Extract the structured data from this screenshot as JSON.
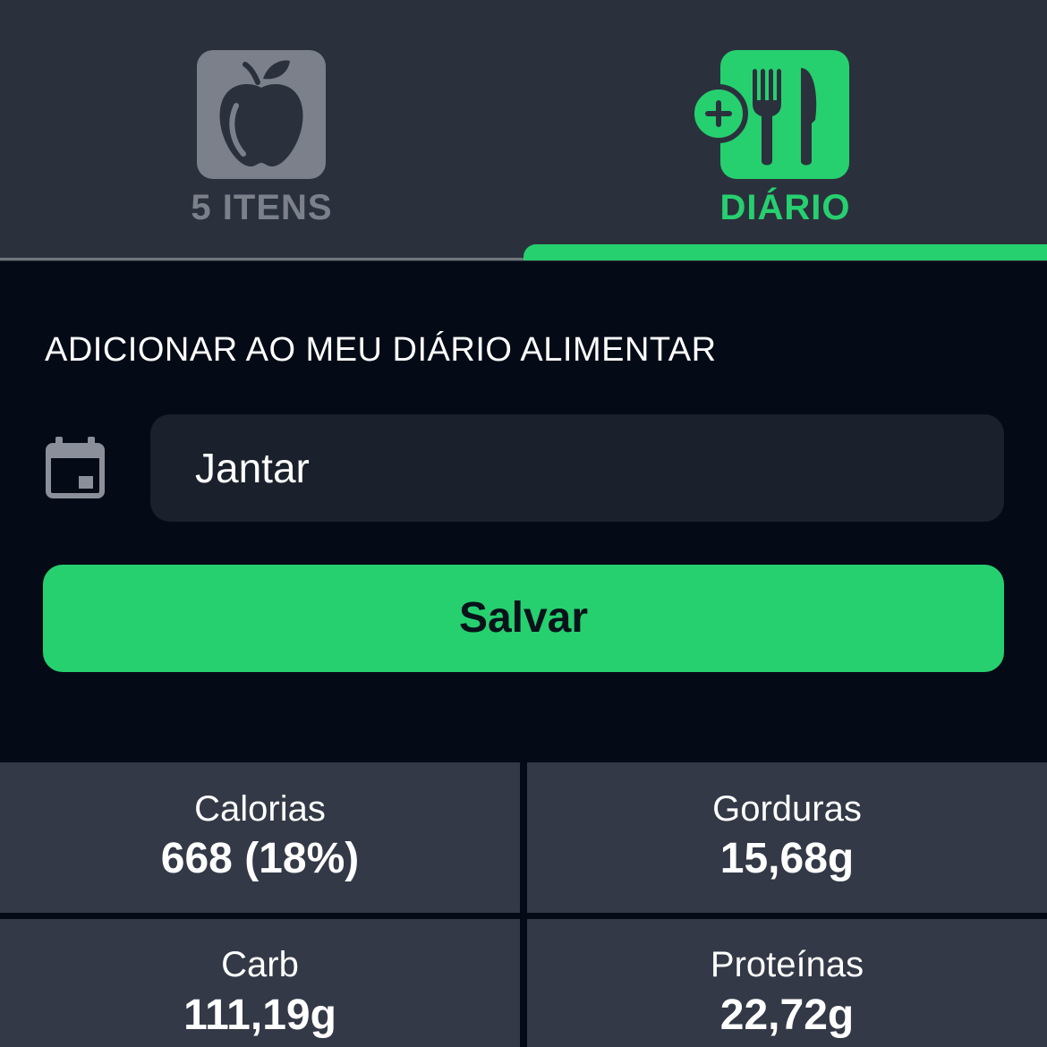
{
  "tabs": [
    {
      "label": "5 ITENS",
      "icon": "apple-icon",
      "active": false
    },
    {
      "label": "DIÁRIO",
      "icon": "fork-knife-plus-icon",
      "active": true
    }
  ],
  "diary_form": {
    "title": "ADICIONAR AO MEU DIÁRIO ALIMENTAR",
    "date_icon": "calendar-icon",
    "meal_value": "Jantar",
    "save_label": "Salvar"
  },
  "nutrition": [
    {
      "label": "Calorias",
      "value": "668 (18%)"
    },
    {
      "label": "Gorduras",
      "value": "15,68g"
    },
    {
      "label": "Carb",
      "value": "111,19g"
    },
    {
      "label": "Proteínas",
      "value": "22,72g"
    }
  ],
  "colors": {
    "accent": "#26d06f",
    "tab_bg": "#2b313c",
    "inactive": "#7b808a",
    "background": "#050b16",
    "field_bg": "#1b212c",
    "cell_bg": "#333946"
  }
}
